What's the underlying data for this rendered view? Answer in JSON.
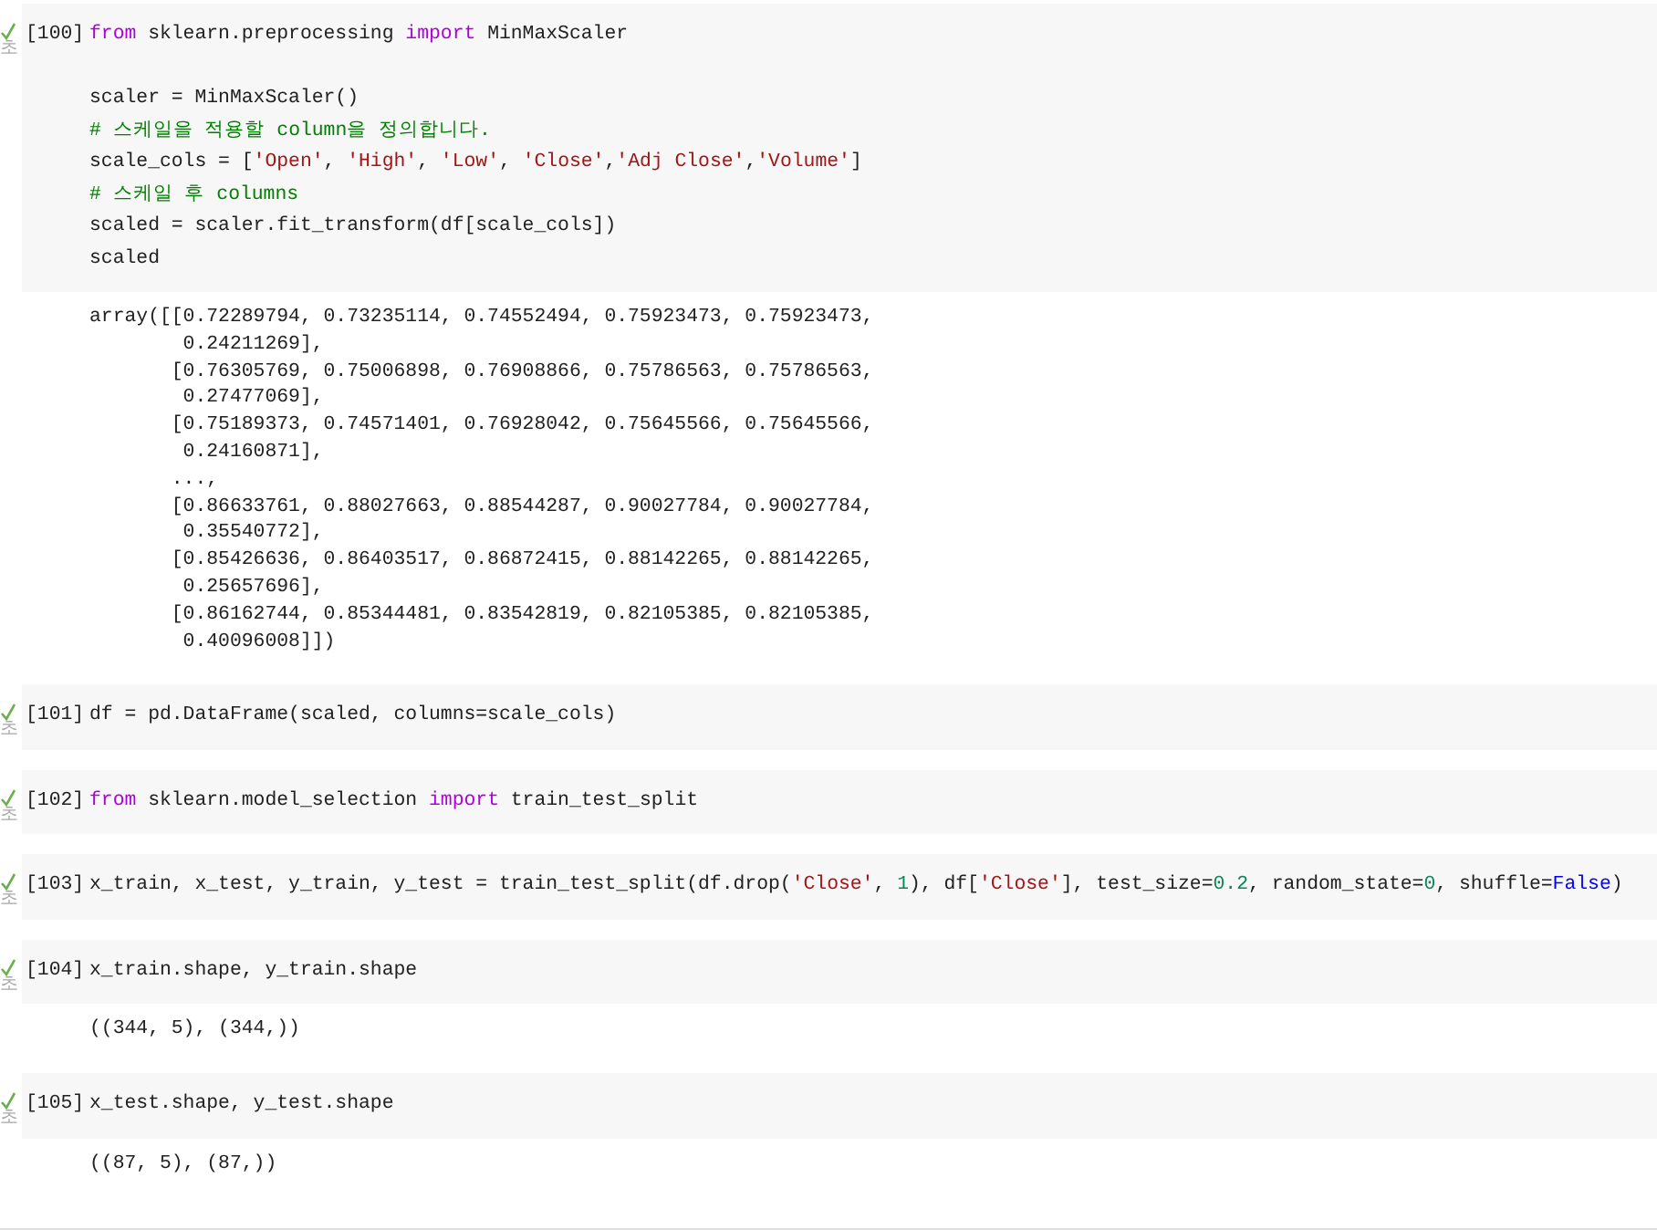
{
  "cells": [
    {
      "count": "[100]",
      "time": "초",
      "blocks": [
        [
          [
            {
              "kind": "keyword",
              "text": "from"
            },
            {
              "kind": "plain",
              "text": " sklearn.preprocessing "
            },
            {
              "kind": "keyword",
              "text": "import"
            },
            {
              "kind": "plain",
              "text": " MinMaxScaler"
            }
          ]
        ],
        [
          [
            {
              "kind": "plain",
              "text": "scaler = MinMaxScaler()"
            }
          ],
          [
            {
              "kind": "comment",
              "text": "# 스케일을 적용할 column을 정의합니다."
            }
          ],
          [
            {
              "kind": "plain",
              "text": "scale_cols = ["
            },
            {
              "kind": "string",
              "text": "'Open'"
            },
            {
              "kind": "plain",
              "text": ", "
            },
            {
              "kind": "string",
              "text": "'High'"
            },
            {
              "kind": "plain",
              "text": ", "
            },
            {
              "kind": "string",
              "text": "'Low'"
            },
            {
              "kind": "plain",
              "text": ", "
            },
            {
              "kind": "string",
              "text": "'Close'"
            },
            {
              "kind": "plain",
              "text": ","
            },
            {
              "kind": "string",
              "text": "'Adj Close'"
            },
            {
              "kind": "plain",
              "text": ","
            },
            {
              "kind": "string",
              "text": "'Volume'"
            },
            {
              "kind": "plain",
              "text": "]"
            }
          ],
          [
            {
              "kind": "comment",
              "text": "# 스케일 후 columns"
            }
          ],
          [
            {
              "kind": "plain",
              "text": "scaled = scaler.fit_transform(df[scale_cols])"
            }
          ],
          [
            {
              "kind": "plain",
              "text": "scaled"
            }
          ]
        ]
      ],
      "output": [
        "array([[0.72289794, 0.73235114, 0.74552494, 0.75923473, 0.75923473,",
        "        0.24211269],",
        "       [0.76305769, 0.75006898, 0.76908866, 0.75786563, 0.75786563,",
        "        0.27477069],",
        "       [0.75189373, 0.74571401, 0.76928042, 0.75645566, 0.75645566,",
        "        0.24160871],",
        "       ...,",
        "       [0.86633761, 0.88027663, 0.88544287, 0.90027784, 0.90027784,",
        "        0.35540772],",
        "       [0.85426636, 0.86403517, 0.86872415, 0.88142265, 0.88142265,",
        "        0.25657696],",
        "       [0.86162744, 0.85344481, 0.83542819, 0.82105385, 0.82105385,",
        "        0.40096008]])"
      ]
    },
    {
      "count": "[101]",
      "time": "초",
      "blocks": [
        [
          [
            {
              "kind": "plain",
              "text": "df = pd.DataFrame(scaled, columns=scale_cols)"
            }
          ]
        ]
      ]
    },
    {
      "count": "[102]",
      "time": "초",
      "blocks": [
        [
          [
            {
              "kind": "keyword",
              "text": "from"
            },
            {
              "kind": "plain",
              "text": " sklearn.model_selection "
            },
            {
              "kind": "keyword",
              "text": "import"
            },
            {
              "kind": "plain",
              "text": " train_test_split"
            }
          ]
        ]
      ]
    },
    {
      "count": "[103]",
      "time": "초",
      "blocks": [
        [
          [
            {
              "kind": "plain",
              "text": "x_train, x_test, y_train, y_test = train_test_split(df.drop("
            },
            {
              "kind": "string",
              "text": "'Close'"
            },
            {
              "kind": "plain",
              "text": ", "
            },
            {
              "kind": "number",
              "text": "1"
            },
            {
              "kind": "plain",
              "text": "), df["
            },
            {
              "kind": "string",
              "text": "'Close'"
            },
            {
              "kind": "plain",
              "text": "], test_size="
            },
            {
              "kind": "number",
              "text": "0.2"
            },
            {
              "kind": "plain",
              "text": ", random_state="
            },
            {
              "kind": "number",
              "text": "0"
            },
            {
              "kind": "plain",
              "text": ", shuffle="
            },
            {
              "kind": "constant",
              "text": "False"
            },
            {
              "kind": "plain",
              "text": ")"
            }
          ]
        ]
      ]
    },
    {
      "count": "[104]",
      "time": "초",
      "blocks": [
        [
          [
            {
              "kind": "plain",
              "text": "x_train.shape, y_train.shape"
            }
          ]
        ]
      ],
      "output": [
        "((344, 5), (344,))"
      ]
    },
    {
      "count": "[105]",
      "time": "초",
      "blocks": [
        [
          [
            {
              "kind": "plain",
              "text": "x_test.shape, y_test.shape"
            }
          ]
        ]
      ],
      "output": [
        "((87, 5), (87,))"
      ]
    }
  ]
}
